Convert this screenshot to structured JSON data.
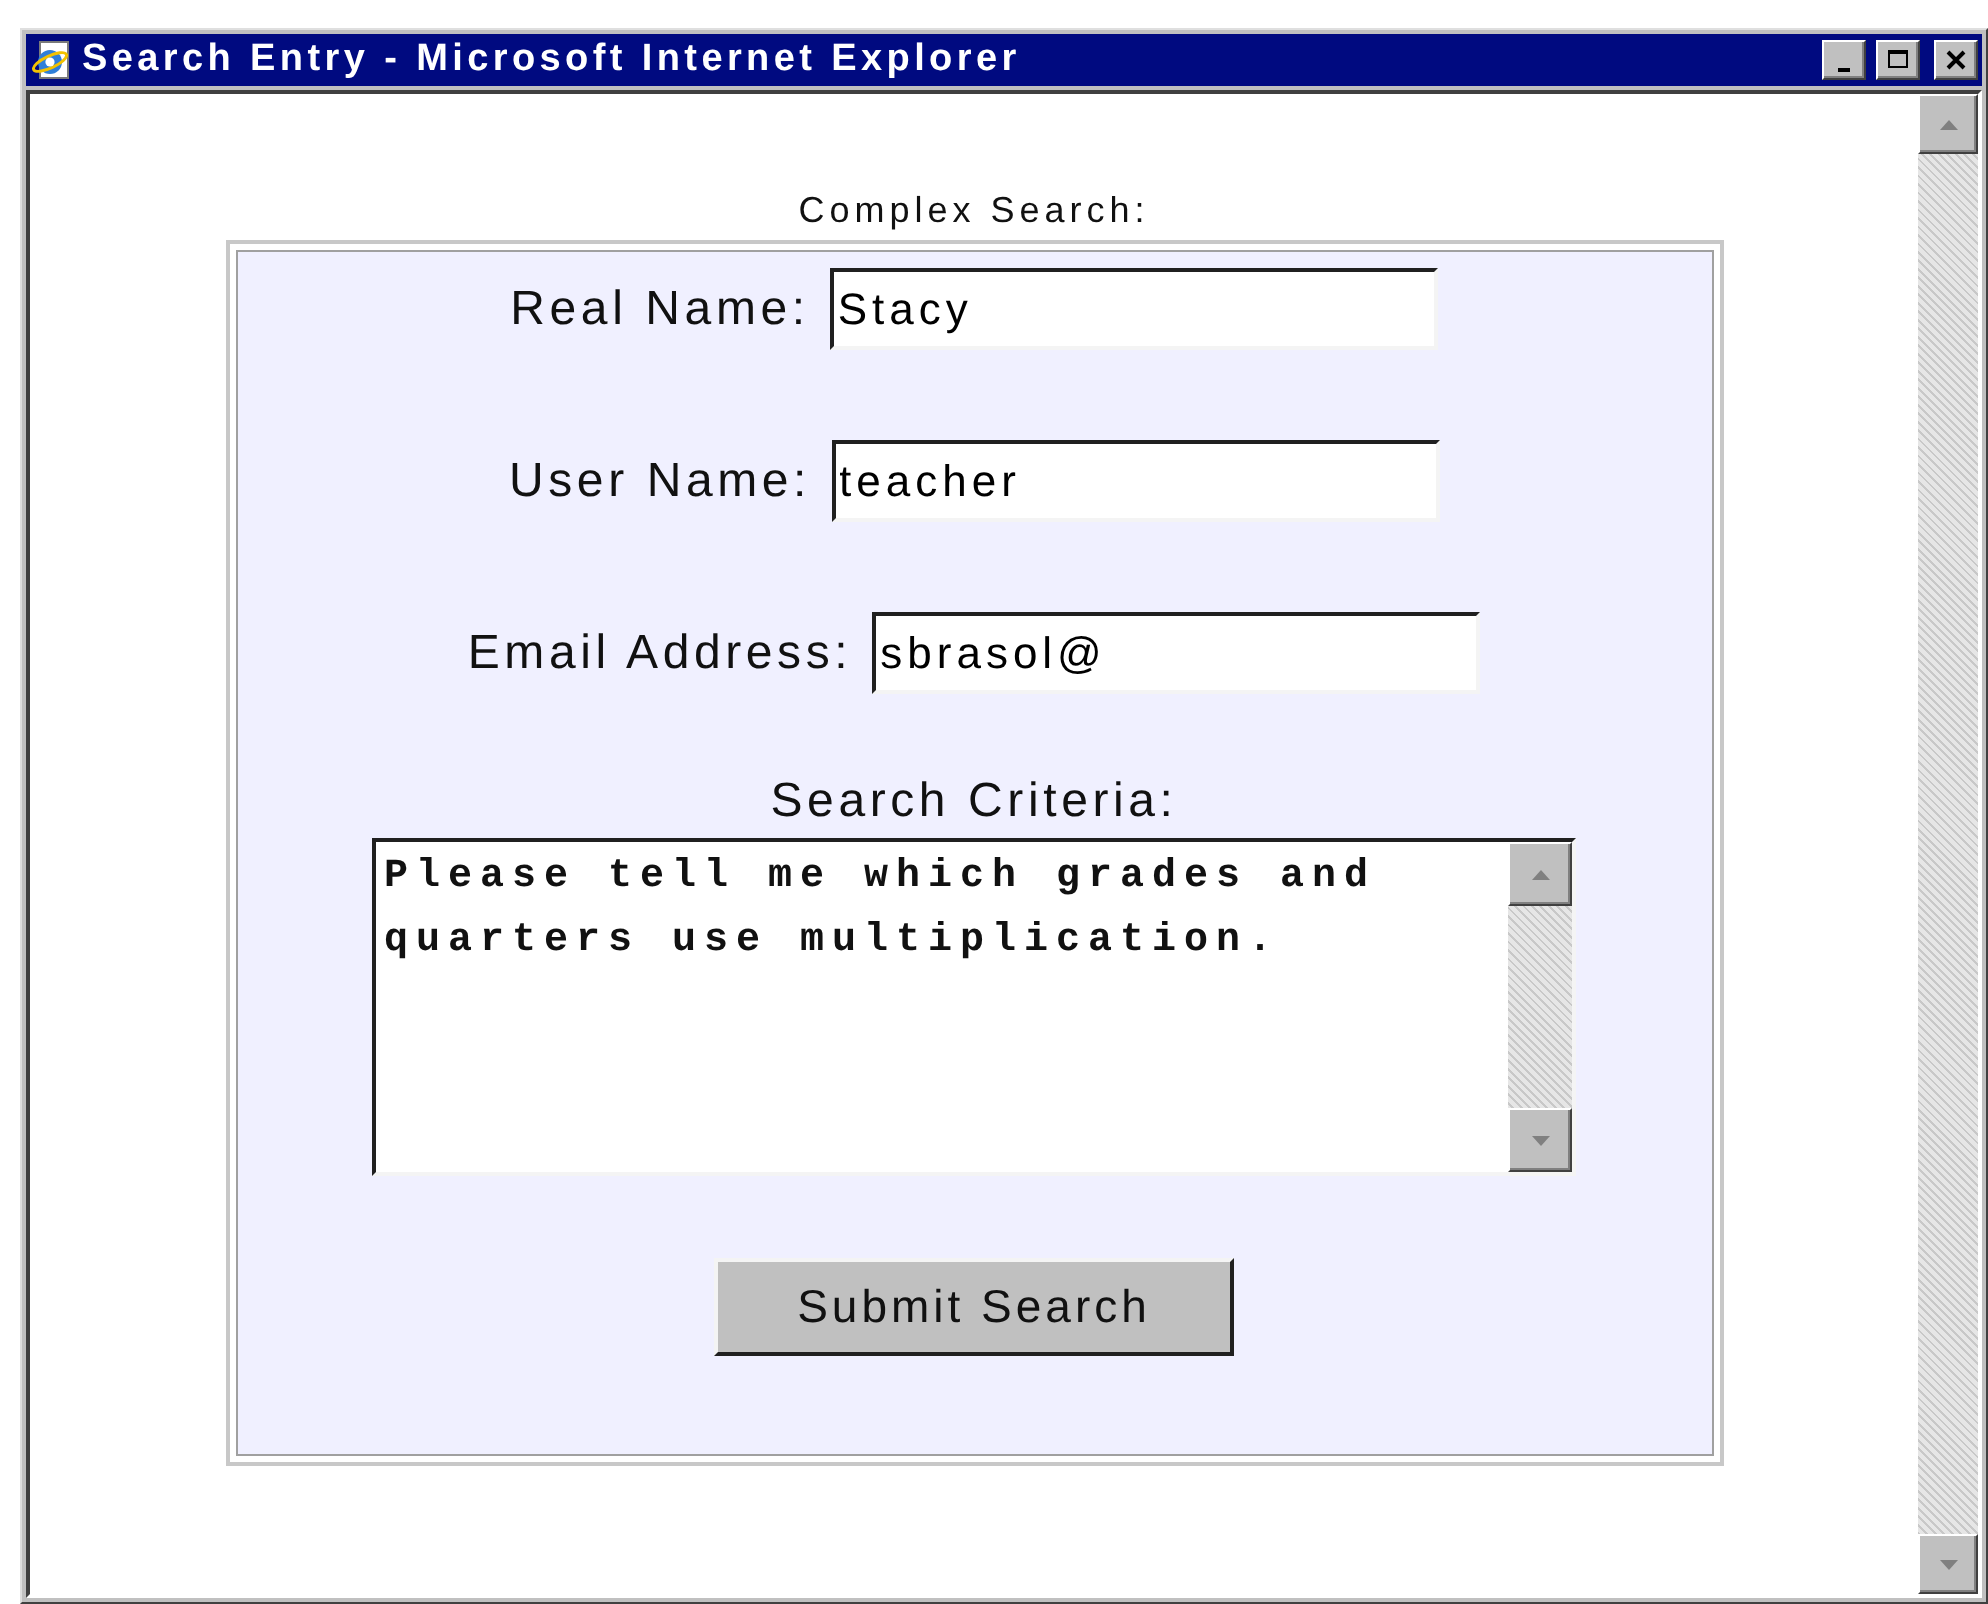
{
  "window": {
    "title": "Search Entry - Microsoft Internet Explorer"
  },
  "form": {
    "heading": "Complex Search:",
    "fields": [
      {
        "label": "Real Name:",
        "value": "Stacy"
      },
      {
        "label": "User Name:",
        "value": "teacher"
      },
      {
        "label": "Email Address:",
        "value": "sbrasol@"
      }
    ],
    "criteria": {
      "label": "Search Criteria:",
      "value": "Please tell me which grades and quarters use multiplication."
    },
    "submit": "Submit Search"
  }
}
